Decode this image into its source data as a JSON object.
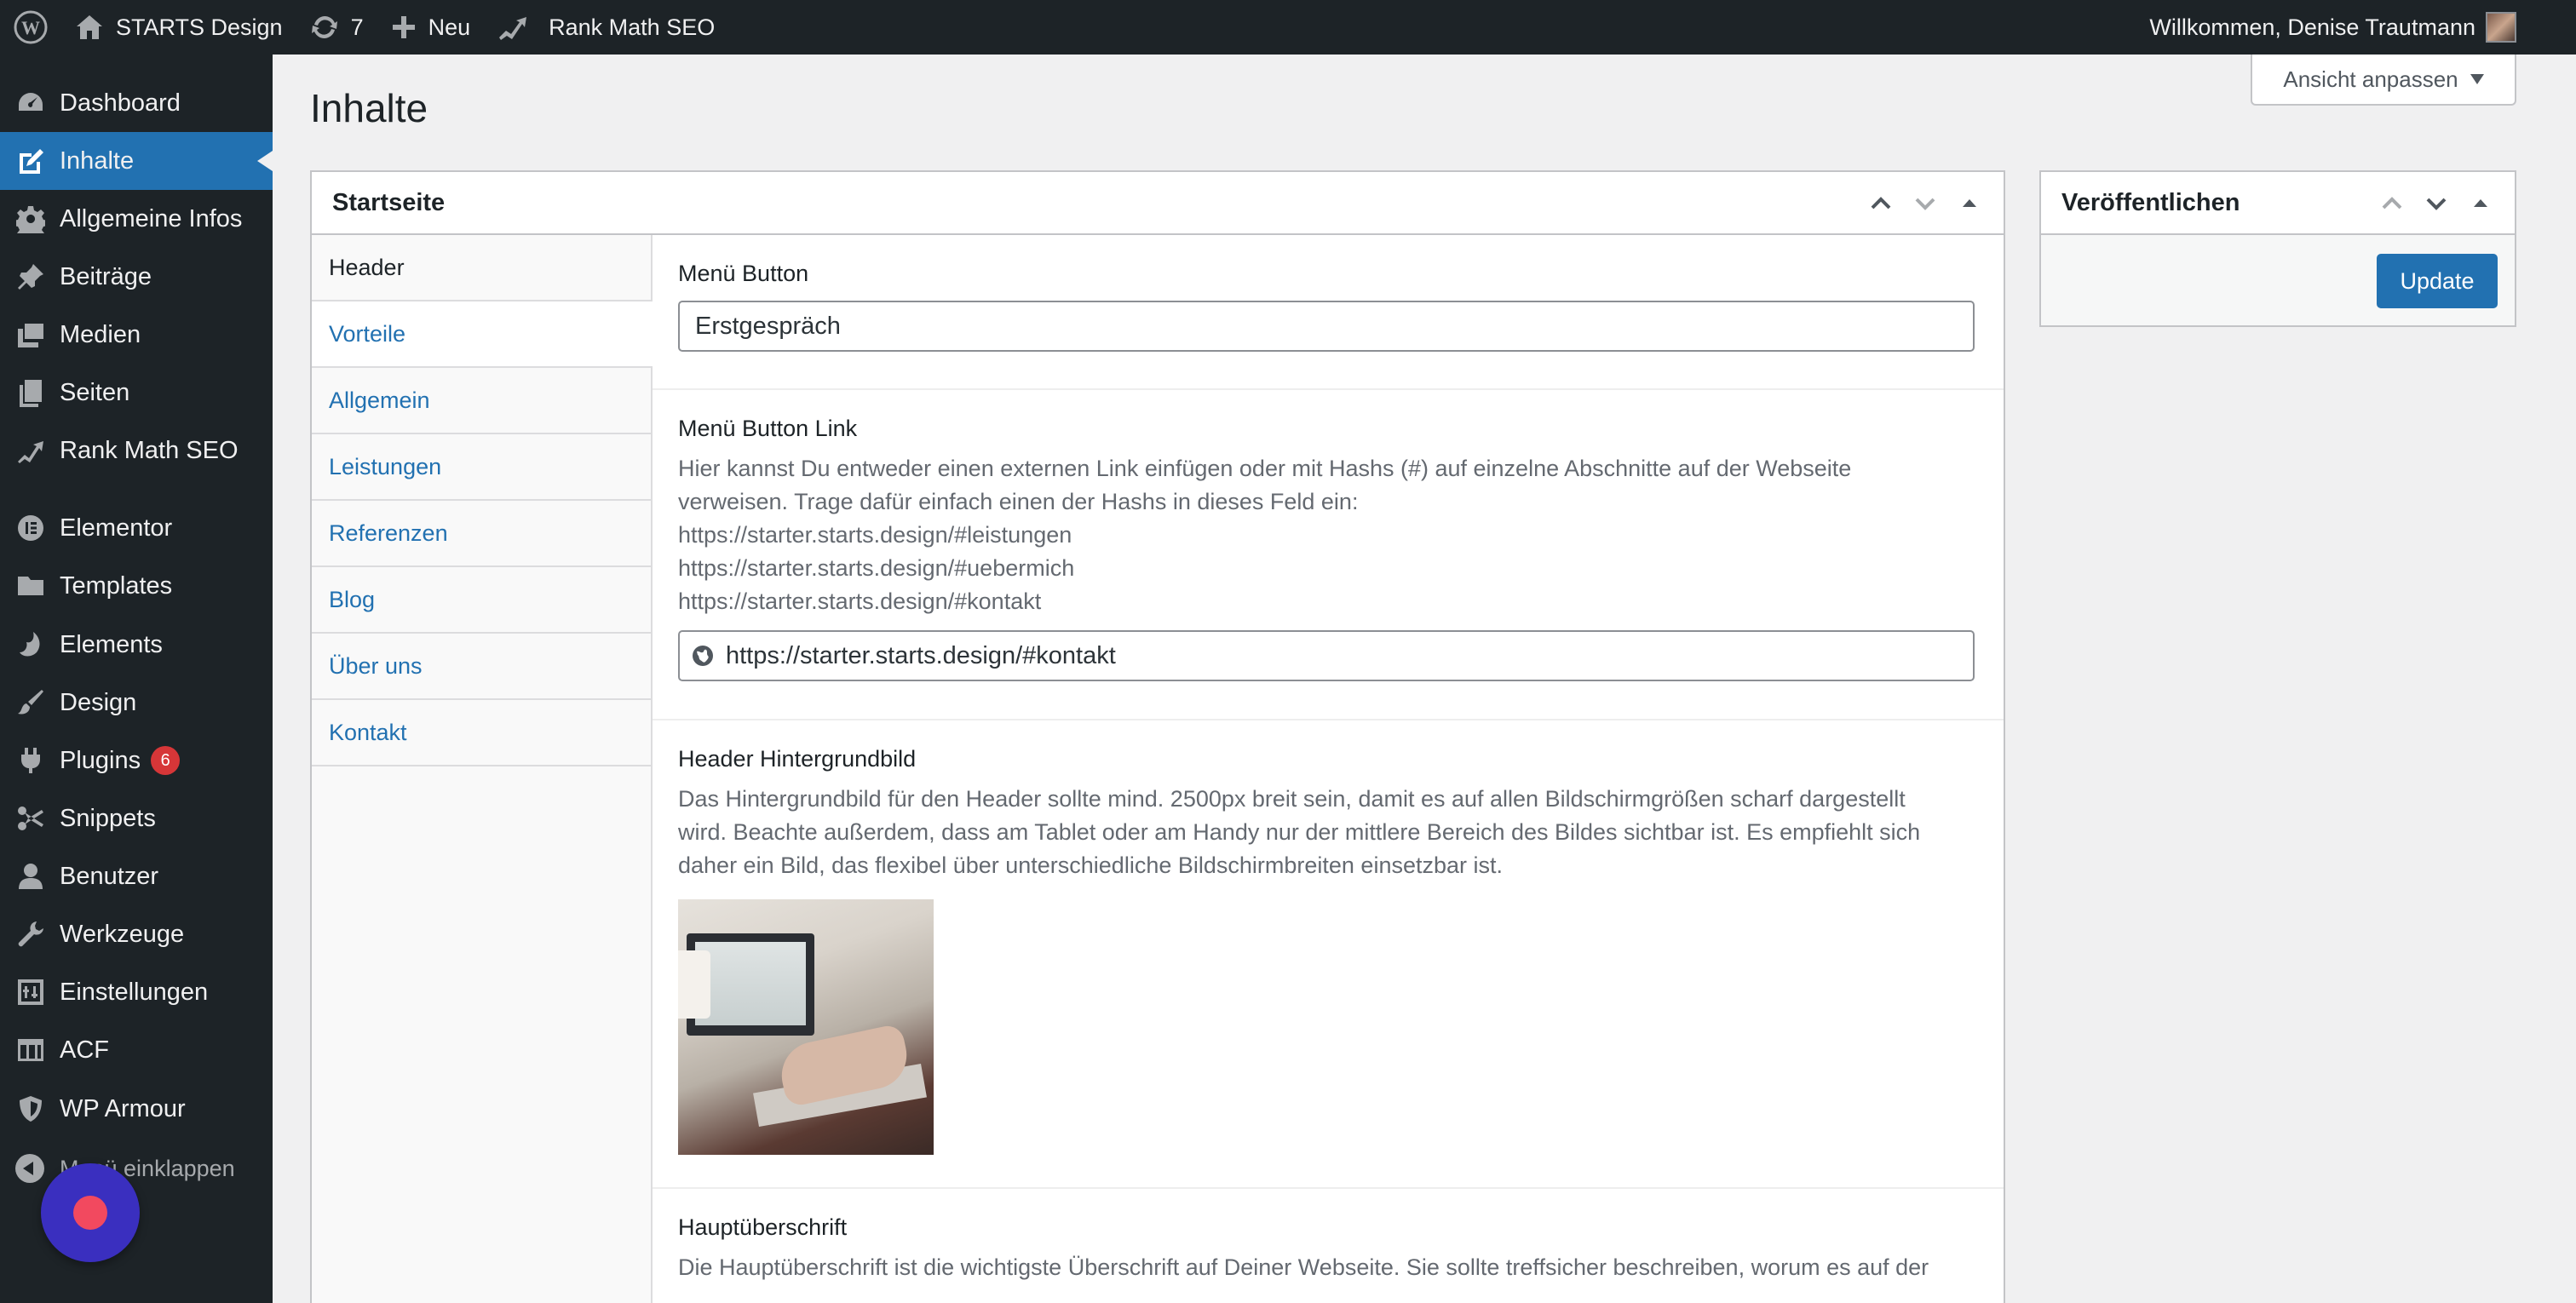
{
  "adminbar": {
    "site_name": "STARTS Design",
    "updates_count": "7",
    "new_label": "Neu",
    "seo_label": "Rank Math SEO",
    "greeting": "Willkommen, Denise Trautmann"
  },
  "sidebar": {
    "items": [
      {
        "label": "Dashboard",
        "icon": "dashboard-icon"
      },
      {
        "label": "Inhalte",
        "icon": "edit-icon"
      },
      {
        "label": "Allgemeine Infos",
        "icon": "gear-icon"
      },
      {
        "label": "Beiträge",
        "icon": "pin-icon"
      },
      {
        "label": "Medien",
        "icon": "media-icon"
      },
      {
        "label": "Seiten",
        "icon": "pages-icon"
      },
      {
        "label": "Rank Math SEO",
        "icon": "rank-math-icon"
      },
      {
        "label": "Elementor",
        "icon": "elementor-icon"
      },
      {
        "label": "Templates",
        "icon": "folder-icon"
      },
      {
        "label": "Elements",
        "icon": "elements-icon"
      },
      {
        "label": "Design",
        "icon": "brush-icon"
      },
      {
        "label": "Plugins",
        "icon": "plugin-icon",
        "badge": "6"
      },
      {
        "label": "Snippets",
        "icon": "scissors-icon"
      },
      {
        "label": "Benutzer",
        "icon": "user-icon"
      },
      {
        "label": "Werkzeuge",
        "icon": "wrench-icon"
      },
      {
        "label": "Einstellungen",
        "icon": "settings-icon"
      },
      {
        "label": "ACF",
        "icon": "table-icon"
      },
      {
        "label": "WP Armour",
        "icon": "shield-icon"
      }
    ],
    "collapse_label": "Menü einklappen"
  },
  "screen_options": {
    "label": "Ansicht anpassen"
  },
  "page": {
    "title": "Inhalte"
  },
  "main_box": {
    "title": "Startseite",
    "tabs": [
      "Header",
      "Vorteile",
      "Allgemein",
      "Leistungen",
      "Referenzen",
      "Blog",
      "Über uns",
      "Kontakt"
    ],
    "fields": {
      "menu_button": {
        "label": "Menü Button",
        "value": "Erstgespräch"
      },
      "menu_button_link": {
        "label": "Menü Button Link",
        "desc_lines": [
          "Hier kannst Du entweder einen externen Link einfügen oder mit Hashs (#) auf einzelne Abschnitte auf der Webseite",
          "verweisen. Trage dafür einfach einen der Hashs in dieses Feld ein:",
          "https://starter.starts.design/#leistungen",
          "https://starter.starts.design/#uebermich",
          "https://starter.starts.design/#kontakt"
        ],
        "value": "https://starter.starts.design/#kontakt"
      },
      "header_bg": {
        "label": "Header Hintergrundbild",
        "desc_lines": [
          "Das Hintergrundbild für den Header sollte mind. 2500px breit sein, damit es auf allen Bildschirmgrößen scharf dargestellt",
          "wird. Beachte außerdem, dass am Tablet oder am Handy nur der mittlere Bereich des Bildes sichtbar ist. Es empfiehlt sich",
          "daher ein Bild, das flexibel über unterschiedliche Bildschirmbreiten einsetzbar ist."
        ]
      },
      "headline": {
        "label": "Hauptüberschrift",
        "desc_lines": [
          "Die Hauptüberschrift ist die wichtigste Überschrift auf Deiner Webseite. Sie sollte treffsicher beschreiben, worum es auf der"
        ]
      }
    }
  },
  "publish_box": {
    "title": "Veröffentlichen",
    "update_label": "Update"
  },
  "colors": {
    "admin_bar": "#1d2327",
    "accent": "#2271b1",
    "badge": "#d63638"
  }
}
